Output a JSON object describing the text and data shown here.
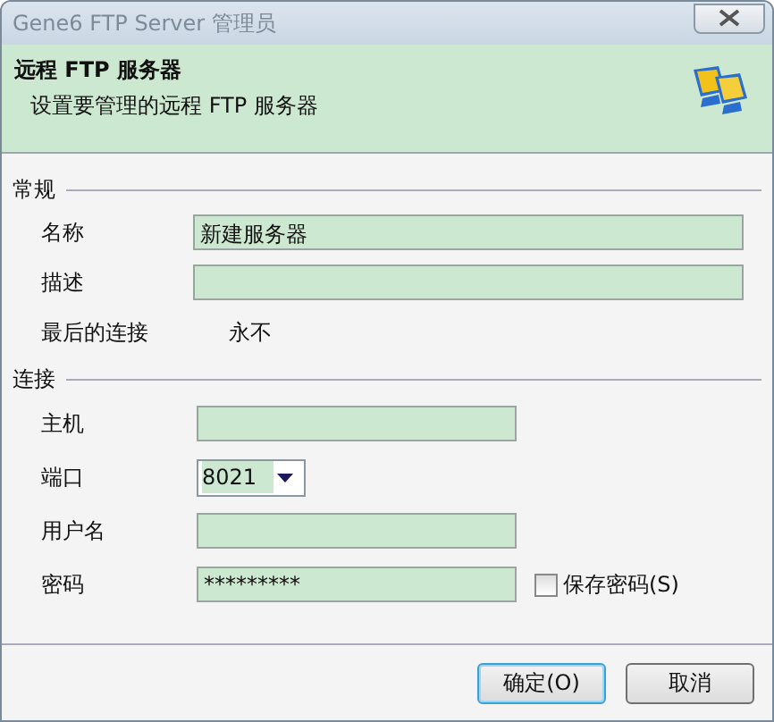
{
  "window": {
    "title": "Gene6 FTP Server 管理员"
  },
  "header": {
    "title": "远程 FTP 服务器",
    "subtitle": "设置要管理的远程 FTP 服务器"
  },
  "general": {
    "heading": "常规",
    "fields": [
      {
        "kind": "input",
        "label": "名称",
        "value": "新建服务器"
      },
      {
        "kind": "input",
        "label": "描述"
      },
      {
        "kind": "text",
        "label": "最后的连接",
        "value": "永不"
      }
    ]
  },
  "connection": {
    "heading": "连接",
    "fields": [
      {
        "kind": "input",
        "label": "主机"
      },
      {
        "kind": "combo",
        "label": "端口",
        "value": "8021"
      },
      {
        "kind": "input",
        "label": "用户名"
      },
      {
        "kind": "password",
        "label": "密码",
        "value": "*********"
      }
    ],
    "save_password": {
      "label": "保存密码(S)",
      "checked": false
    }
  },
  "buttons": [
    {
      "label": "确定(O)",
      "default": true
    },
    {
      "label": "取消",
      "default": false
    }
  ]
}
